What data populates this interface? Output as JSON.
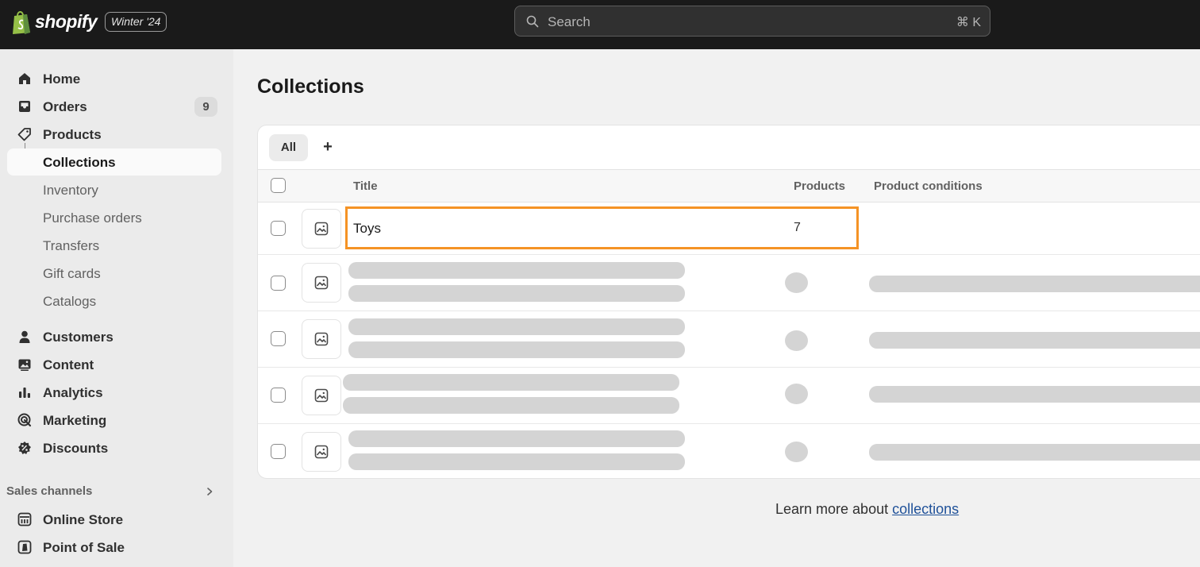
{
  "topbar": {
    "brand": "shopify",
    "edition": "Winter '24",
    "search_placeholder": "Search",
    "search_shortcut": "⌘ K"
  },
  "sidebar": {
    "items": [
      {
        "label": "Home",
        "icon": "home-icon"
      },
      {
        "label": "Orders",
        "icon": "inbox-icon",
        "badge": "9"
      },
      {
        "label": "Products",
        "icon": "tag-icon"
      },
      {
        "label": "Collections",
        "active": true
      },
      {
        "label": "Inventory"
      },
      {
        "label": "Purchase orders"
      },
      {
        "label": "Transfers"
      },
      {
        "label": "Gift cards"
      },
      {
        "label": "Catalogs"
      },
      {
        "label": "Customers",
        "icon": "person-icon"
      },
      {
        "label": "Content",
        "icon": "image-icon"
      },
      {
        "label": "Analytics",
        "icon": "bar-chart-icon"
      },
      {
        "label": "Marketing",
        "icon": "target-icon"
      },
      {
        "label": "Discounts",
        "icon": "discount-icon"
      }
    ],
    "sales_channels_title": "Sales channels",
    "channels": [
      {
        "label": "Online Store",
        "icon": "store-icon"
      },
      {
        "label": "Point of Sale",
        "icon": "pos-icon"
      }
    ]
  },
  "main": {
    "title": "Collections",
    "tabs": [
      {
        "label": "All"
      }
    ],
    "add_tab_label": "+",
    "columns": [
      "Title",
      "Products",
      "Product conditions"
    ],
    "rows": [
      {
        "title": "Toys",
        "products": "7"
      }
    ],
    "footer_prefix": "Learn more about ",
    "footer_link": "collections"
  },
  "colors": {
    "topbar_bg": "#1a1a1a",
    "highlight": "#f59325",
    "link": "#1f5199"
  }
}
